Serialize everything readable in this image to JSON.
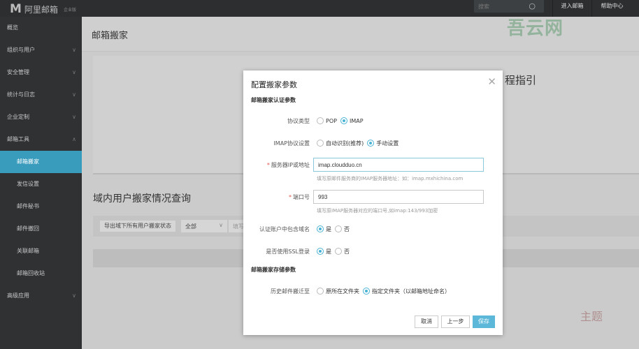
{
  "app": {
    "logo_mark": "M",
    "name": "阿里邮箱",
    "edition": "企业版"
  },
  "topbar": {
    "search_placeholder": "搜索",
    "enter_mail": "进入邮箱",
    "help": "帮助中心"
  },
  "sidebar": {
    "items": [
      {
        "label": "概览"
      },
      {
        "label": "组织与用户",
        "chevron": "∨"
      },
      {
        "label": "安全管理",
        "chevron": "∨"
      },
      {
        "label": "统计与日志",
        "chevron": "∨"
      },
      {
        "label": "企业定制",
        "chevron": "∨"
      },
      {
        "label": "邮箱工具",
        "chevron": "∧"
      },
      {
        "label": "邮箱搬家",
        "active": true
      },
      {
        "label": "发信设置"
      },
      {
        "label": "邮件秘书"
      },
      {
        "label": "邮件撤回"
      },
      {
        "label": "关联邮箱"
      },
      {
        "label": "邮箱回收站"
      },
      {
        "label": "高级应用",
        "chevron": "∨"
      }
    ]
  },
  "main": {
    "title": "邮箱搬家",
    "guide_fragment": "程指引",
    "query_title": "域内用户搬家情况查询",
    "export_button": "导出域下所有用户搬家状态",
    "status_select": "全部",
    "filter_placeholder": "填写"
  },
  "watermarks": [
    "吾云网",
    "主题"
  ],
  "modal": {
    "title": "配置搬家参数",
    "section_auth": "邮箱搬家认证参数",
    "section_storage": "邮箱搬家存储参数",
    "protocol": {
      "label": "协议类型",
      "options": [
        "POP",
        "IMAP"
      ],
      "selected": "IMAP"
    },
    "imap_setting": {
      "label": "IMAP协议设置",
      "options": [
        "自动识别(推荐)",
        "手动设置"
      ],
      "selected": "手动设置"
    },
    "server": {
      "label": "服务器IP或地址",
      "value": "imap.cloudduo.cn",
      "hint": "填写原邮件服务商的IMAP服务器地址：如：imap.mxhichina.com"
    },
    "port": {
      "label": "端口号",
      "value": "993",
      "hint": "填写原IMAP服务器对应的端口号,如imap:143/993加密"
    },
    "domain_in_account": {
      "label": "认证账户中包含域名",
      "options": [
        "是",
        "否"
      ],
      "selected": "是"
    },
    "ssl": {
      "label": "是否使用SSL登录",
      "options": [
        "是",
        "否"
      ],
      "selected": "是"
    },
    "history": {
      "label": "历史邮件搬迁至",
      "options": [
        "原所在文件夹",
        "指定文件夹（以邮箱地址命名）"
      ],
      "selected": "指定文件夹（以邮箱地址命名）"
    },
    "buttons": {
      "cancel": "取消",
      "prev": "上一步",
      "save": "保存"
    }
  },
  "colors": {
    "accent": "#4ab3d4",
    "sidebar": "#2f3133",
    "active": "#3a9cbd"
  }
}
